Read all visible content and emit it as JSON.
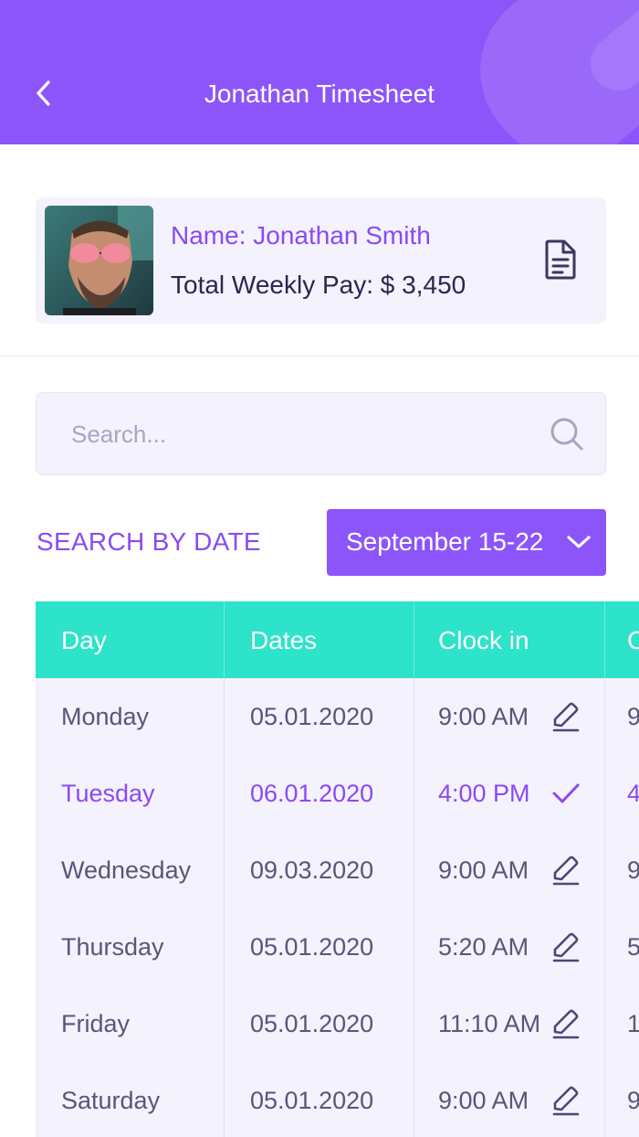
{
  "header": {
    "title": "Jonathan Timesheet",
    "back_icon": "chevron-left-icon",
    "background": "#8c55fa"
  },
  "profile": {
    "name": "Name: Jonathan Smith",
    "weekly_pay": "Total Weekly Pay: $ 3,450",
    "document_icon": "document-icon"
  },
  "search": {
    "placeholder": "Search...",
    "value": "",
    "icon": "search-icon"
  },
  "date_filter": {
    "label": "SEARCH BY DATE",
    "selected": "September 15-22",
    "icon": "chevron-down-icon"
  },
  "table": {
    "headers": [
      "Day",
      "Dates",
      "Clock in",
      "C"
    ],
    "rows": [
      {
        "day": "Monday",
        "date": "05.01.2020",
        "clock_in": "9:00 AM",
        "next": "9",
        "action": "edit-icon",
        "active": false
      },
      {
        "day": "Tuesday",
        "date": "06.01.2020",
        "clock_in": "4:00 PM",
        "next": "4",
        "action": "check-icon",
        "active": true
      },
      {
        "day": "Wednesday",
        "date": "09.03.2020",
        "clock_in": "9:00 AM",
        "next": "9",
        "action": "edit-icon",
        "active": false
      },
      {
        "day": "Thursday",
        "date": "05.01.2020",
        "clock_in": "5:20 AM",
        "next": "5",
        "action": "edit-icon",
        "active": false
      },
      {
        "day": "Friday",
        "date": "05.01.2020",
        "clock_in": "11:10 AM",
        "next": "1",
        "action": "edit-icon",
        "active": false
      },
      {
        "day": "Saturday",
        "date": "05.01.2020",
        "clock_in": "9:00 AM",
        "next": "9",
        "action": "edit-icon",
        "active": false
      }
    ]
  },
  "colors": {
    "accent": "#8a4af3",
    "table_header": "#2de3c9",
    "card_bg": "#f4f2fc"
  }
}
